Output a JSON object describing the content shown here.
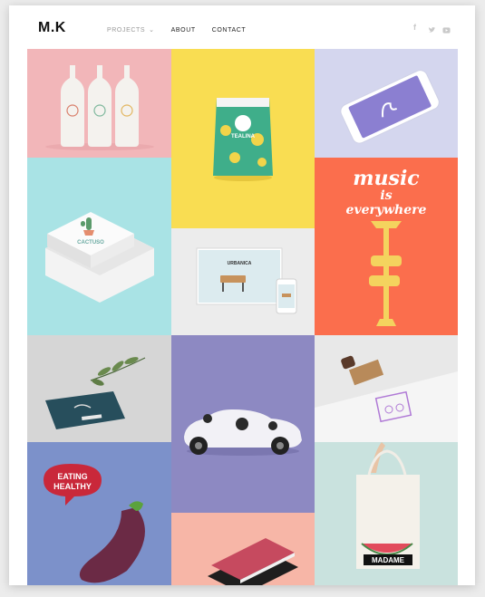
{
  "header": {
    "logo": "M.K",
    "nav": [
      {
        "label": "PROJECTS",
        "dropdown": true
      },
      {
        "label": "ABOUT"
      },
      {
        "label": "CONTACT"
      }
    ],
    "social_icons": [
      "facebook-icon",
      "twitter-icon",
      "youtube-icon"
    ]
  },
  "portfolio": {
    "items": [
      {
        "name": "wine-bottles",
        "bg": "#f2b6b9"
      },
      {
        "name": "tealina-pouch",
        "bg": "#f9dd52",
        "label": "TEALINA"
      },
      {
        "name": "phone-app",
        "bg": "#d4d6ee"
      },
      {
        "name": "cactuso-box",
        "bg": "#a9e3e5",
        "label": "CACTUSO"
      },
      {
        "name": "urbanica-web",
        "bg": "#ececec",
        "label": "URBANICA"
      },
      {
        "name": "music-poster",
        "bg": "#fb6e4d",
        "lines": [
          "music",
          "is",
          "everywhere"
        ]
      },
      {
        "name": "business-card",
        "bg": "#d6d6d6"
      },
      {
        "name": "car-wrap",
        "bg": "#8d89c2"
      },
      {
        "name": "stamp",
        "bg": "#e8e8e8"
      },
      {
        "name": "eating-healthy",
        "bg": "#7c91ca",
        "lines": [
          "EATING",
          "HEALTHY"
        ]
      },
      {
        "name": "books",
        "bg": "#f7b6a7"
      },
      {
        "name": "madame-tote",
        "bg": "#c9e2de",
        "label": "MADAME"
      }
    ]
  }
}
